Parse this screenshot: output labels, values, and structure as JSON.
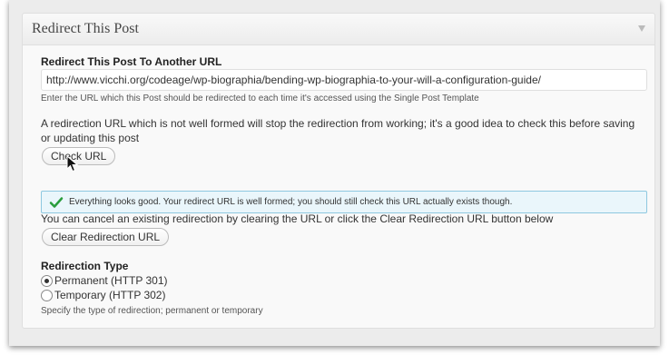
{
  "postbox": {
    "title": "Redirect This Post"
  },
  "redirect_url": {
    "label": "Redirect This Post To Another URL",
    "value": "http://www.vicchi.org/codeage/wp-biographia/bending-wp-biographia-to-your-will-a-configuration-guide/",
    "description": "Enter the URL which this Post should be redirected to each time it's accessed using the Single Post Template"
  },
  "check": {
    "warning_line1": "A redirection URL which is not well formed will stop the redirection from working; it's a good idea to check this before saving",
    "warning_line2": "or updating this post",
    "button_label": "Check URL"
  },
  "notice": {
    "message": "Everything looks good. Your redirect URL is well formed; you should still check this URL actually exists though.",
    "icon": "checkmark-icon",
    "color": "#2a9d3c"
  },
  "clear": {
    "text": "You can cancel an existing redirection by clearing the URL or click the Clear Redirection URL button below",
    "button_label": "Clear Redirection URL"
  },
  "redirection_type": {
    "label": "Redirection Type",
    "options": [
      {
        "label": "Permanent (HTTP 301)",
        "selected": true
      },
      {
        "label": "Temporary (HTTP 302)",
        "selected": false
      }
    ],
    "description": "Specify the type of redirection; permanent or temporary"
  }
}
